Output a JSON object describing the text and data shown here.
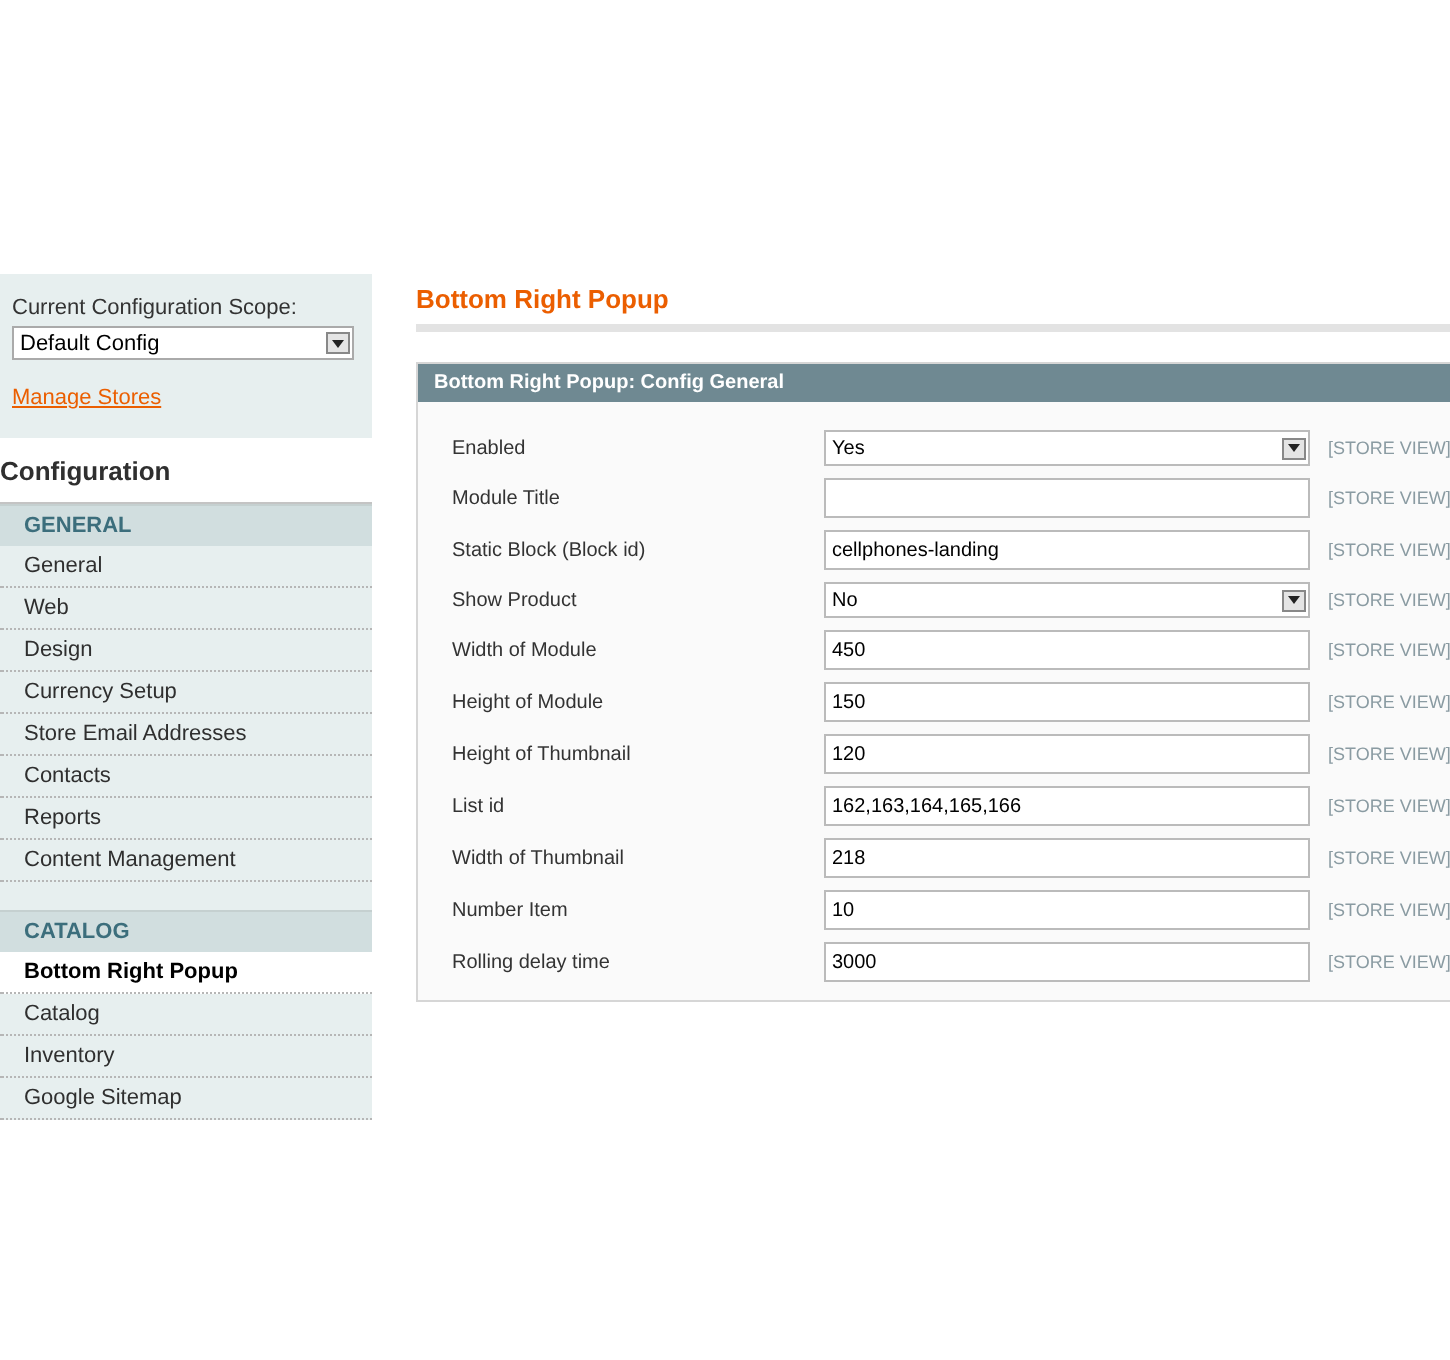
{
  "scope": {
    "label": "Current Configuration Scope:",
    "value": "Default Config",
    "link": "Manage Stores"
  },
  "sidebar": {
    "title": "Configuration",
    "groups": [
      {
        "title": "GENERAL",
        "items": [
          {
            "label": "General",
            "selected": false
          },
          {
            "label": "Web",
            "selected": false
          },
          {
            "label": "Design",
            "selected": false
          },
          {
            "label": "Currency Setup",
            "selected": false
          },
          {
            "label": "Store Email Addresses",
            "selected": false
          },
          {
            "label": "Contacts",
            "selected": false
          },
          {
            "label": "Reports",
            "selected": false
          },
          {
            "label": "Content Management",
            "selected": false
          }
        ]
      },
      {
        "title": "CATALOG",
        "items": [
          {
            "label": "Bottom Right Popup",
            "selected": true
          },
          {
            "label": "Catalog",
            "selected": false
          },
          {
            "label": "Inventory",
            "selected": false
          },
          {
            "label": "Google Sitemap",
            "selected": false
          }
        ]
      }
    ]
  },
  "page_title": "Bottom Right Popup",
  "section": {
    "title": "Bottom Right Popup: Config General",
    "fields": [
      {
        "label": "Enabled",
        "kind": "select",
        "value": "Yes",
        "scope": "[STORE VIEW]"
      },
      {
        "label": "Module Title",
        "kind": "text",
        "scope": "[STORE VIEW]"
      },
      {
        "label": "Static Block (Block id)",
        "kind": "text",
        "value": "cellphones-landing",
        "scope": "[STORE VIEW]"
      },
      {
        "label": "Show Product",
        "kind": "select",
        "value": "No",
        "scope": "[STORE VIEW]"
      },
      {
        "label": "Width of Module",
        "kind": "text",
        "value": "450",
        "scope": "[STORE VIEW]"
      },
      {
        "label": "Height of Module",
        "kind": "text",
        "value": "150",
        "scope": "[STORE VIEW]"
      },
      {
        "label": "Height of Thumbnail",
        "kind": "text",
        "value": "120",
        "scope": "[STORE VIEW]"
      },
      {
        "label": "List id",
        "kind": "text",
        "value": "162,163,164,165,166",
        "scope": "[STORE VIEW]"
      },
      {
        "label": "Width of Thumbnail",
        "kind": "text",
        "value": "218",
        "scope": "[STORE VIEW]"
      },
      {
        "label": "Number Item",
        "kind": "text",
        "value": "10",
        "scope": "[STORE VIEW]"
      },
      {
        "label": "Rolling delay time",
        "kind": "text",
        "value": "3000",
        "scope": "[STORE VIEW]"
      }
    ]
  }
}
